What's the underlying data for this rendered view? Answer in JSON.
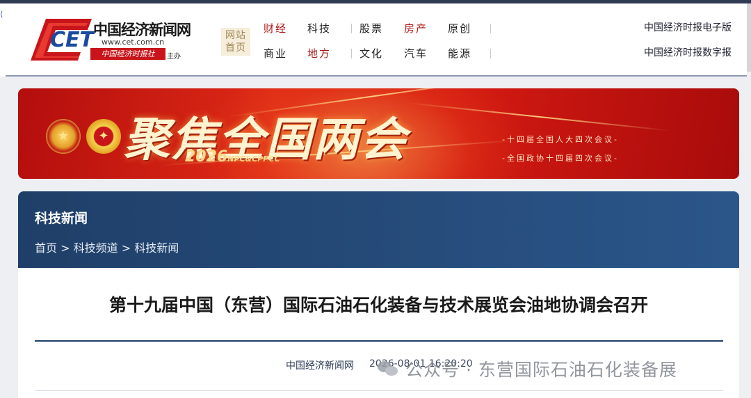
{
  "header": {
    "logo": {
      "name": "中国经济新闻网",
      "url": "www.cet.com.cn",
      "paper": "中国经济时报社",
      "host": "主办"
    },
    "home_line1": "网站",
    "home_line2": "首页",
    "nav_row1": [
      {
        "label": "财经",
        "color": "red"
      },
      {
        "label": "科技",
        "color": "normal"
      },
      {
        "label": "股票",
        "color": "normal"
      },
      {
        "label": "房产",
        "color": "red"
      },
      {
        "label": "原创",
        "color": "normal"
      }
    ],
    "nav_row2": [
      {
        "label": "商业",
        "color": "normal"
      },
      {
        "label": "地方",
        "color": "red"
      },
      {
        "label": "文化",
        "color": "normal"
      },
      {
        "label": "汽车",
        "color": "normal"
      },
      {
        "label": "能源",
        "color": "normal"
      }
    ],
    "ext_links": [
      "中国经济时报电子版",
      "中国经济时报数字报"
    ]
  },
  "banner": {
    "title": "聚焦全国两会",
    "year": "2026",
    "tag": "NPC&CPPCC",
    "sub1": "十四届全国人大四次会议",
    "sub2": "全国政协十四届四次会议"
  },
  "section": {
    "title": "科技新闻",
    "breadcrumb": [
      "首页",
      "科技频道",
      "科技新闻"
    ],
    "breadcrumb_sep": ">"
  },
  "article": {
    "title": "第十九届中国（东营）国际石油石化装备与技术展览会油地协调会召开",
    "source": "中国经济新闻网",
    "time": "2026-08-01 16:20:20"
  },
  "watermark": "公众号 · 东营国际石油石化装备展",
  "colors": {
    "accent_red": "#b01818",
    "section_blue": "#1f3f68",
    "banner_red": "#d41a12"
  }
}
